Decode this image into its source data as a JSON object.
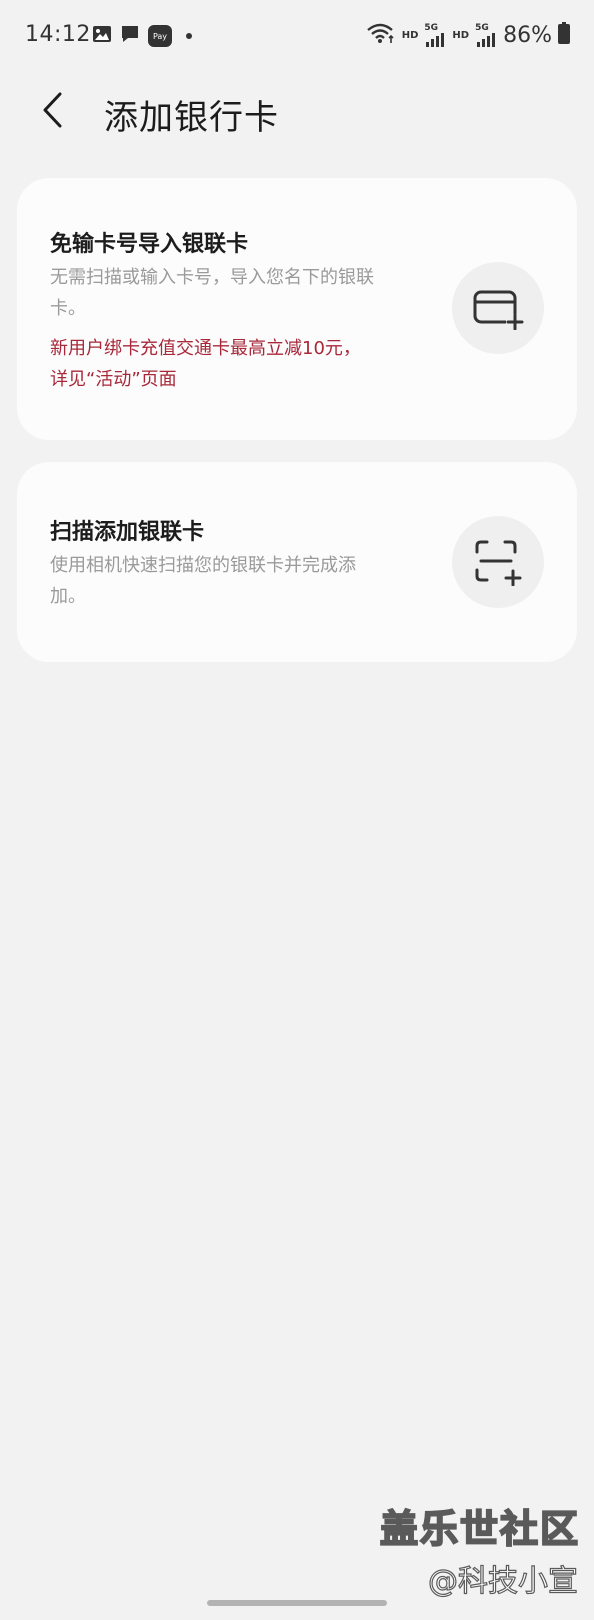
{
  "status_bar": {
    "time": "14:12",
    "pay_label": "Pay",
    "hd_label_1": "HD",
    "fiveg_label_1": "5G",
    "hd_label_2": "HD",
    "fiveg_label_2": "5G",
    "battery_percent": "86%"
  },
  "header": {
    "title": "添加银行卡"
  },
  "cards": [
    {
      "title": "免输卡号导入银联卡",
      "description": "无需扫描或输入卡号，导入您名下的银联卡。",
      "promo": "新用户绑卡充值交通卡最高立减10元， 详见“活动”页面",
      "icon": "card-plus-icon"
    },
    {
      "title": "扫描添加银联卡",
      "description": "使用相机快速扫描您的银联卡并完成添加。",
      "icon": "scan-plus-icon"
    }
  ],
  "watermark": {
    "line1": "盖乐世社区",
    "line2": "@科技小宣"
  },
  "colors": {
    "background": "#f2f2f2",
    "card": "#fcfcfc",
    "promo_red": "#a8283a",
    "secondary_text": "#9a9a9a"
  }
}
